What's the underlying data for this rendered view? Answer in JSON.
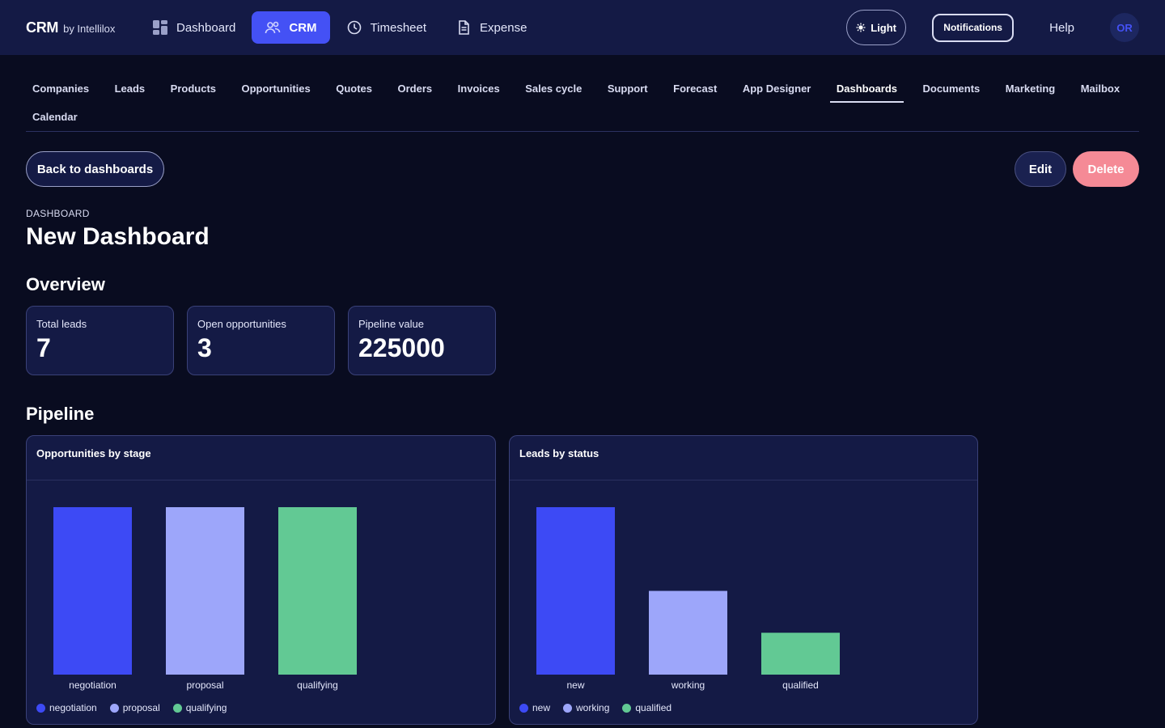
{
  "brand": {
    "name": "CRM",
    "by": "by Intellilox"
  },
  "topnav": [
    {
      "label": "Dashboard",
      "icon": "dashboard-icon",
      "active": false
    },
    {
      "label": "CRM",
      "icon": "users-icon",
      "active": true
    },
    {
      "label": "Timesheet",
      "icon": "clock-icon",
      "active": false
    },
    {
      "label": "Expense",
      "icon": "document-icon",
      "active": false
    }
  ],
  "topright": {
    "theme_label": "Light",
    "notifications_label": "Notifications",
    "help_label": "Help",
    "avatar_initials": "OR"
  },
  "subnav": {
    "row1": [
      "Companies",
      "Leads",
      "Products",
      "Opportunities",
      "Quotes",
      "Orders",
      "Invoices",
      "Sales cycle",
      "Support",
      "Forecast",
      "App Designer",
      "Dashboards",
      "Documents",
      "Marketing",
      "Mailbox"
    ],
    "row2": [
      "Calendar"
    ],
    "active": "Dashboards"
  },
  "actions": {
    "back_label": "Back to dashboards",
    "edit_label": "Edit",
    "delete_label": "Delete"
  },
  "page": {
    "eyebrow": "DASHBOARD",
    "title": "New Dashboard",
    "overview_title": "Overview",
    "pipeline_title": "Pipeline"
  },
  "kpis": [
    {
      "label": "Total leads",
      "value": "7"
    },
    {
      "label": "Open opportunities",
      "value": "3"
    },
    {
      "label": "Pipeline value",
      "value": "225000"
    }
  ],
  "colors": {
    "blue": "#3d4af5",
    "lavender": "#9da6fa",
    "green": "#62c994",
    "delete": "#f58a96",
    "accent": "#4451f5"
  },
  "chart_data": [
    {
      "type": "bar",
      "title": "Opportunities by stage",
      "categories": [
        "negotiation",
        "proposal",
        "qualifying"
      ],
      "values": [
        1,
        1,
        1
      ],
      "colors": [
        "#3d4af5",
        "#9da6fa",
        "#62c994"
      ],
      "legend": [
        "negotiation",
        "proposal",
        "qualifying"
      ],
      "legend_position": "bottom-left",
      "ylim": [
        0,
        1
      ],
      "grid": false
    },
    {
      "type": "bar",
      "title": "Leads by status",
      "categories": [
        "new",
        "working",
        "qualified"
      ],
      "values": [
        4,
        2,
        1
      ],
      "colors": [
        "#3d4af5",
        "#9da6fa",
        "#62c994"
      ],
      "legend": [
        "new",
        "working",
        "qualified"
      ],
      "legend_position": "bottom-left",
      "ylim": [
        0,
        4
      ],
      "grid": false
    }
  ]
}
